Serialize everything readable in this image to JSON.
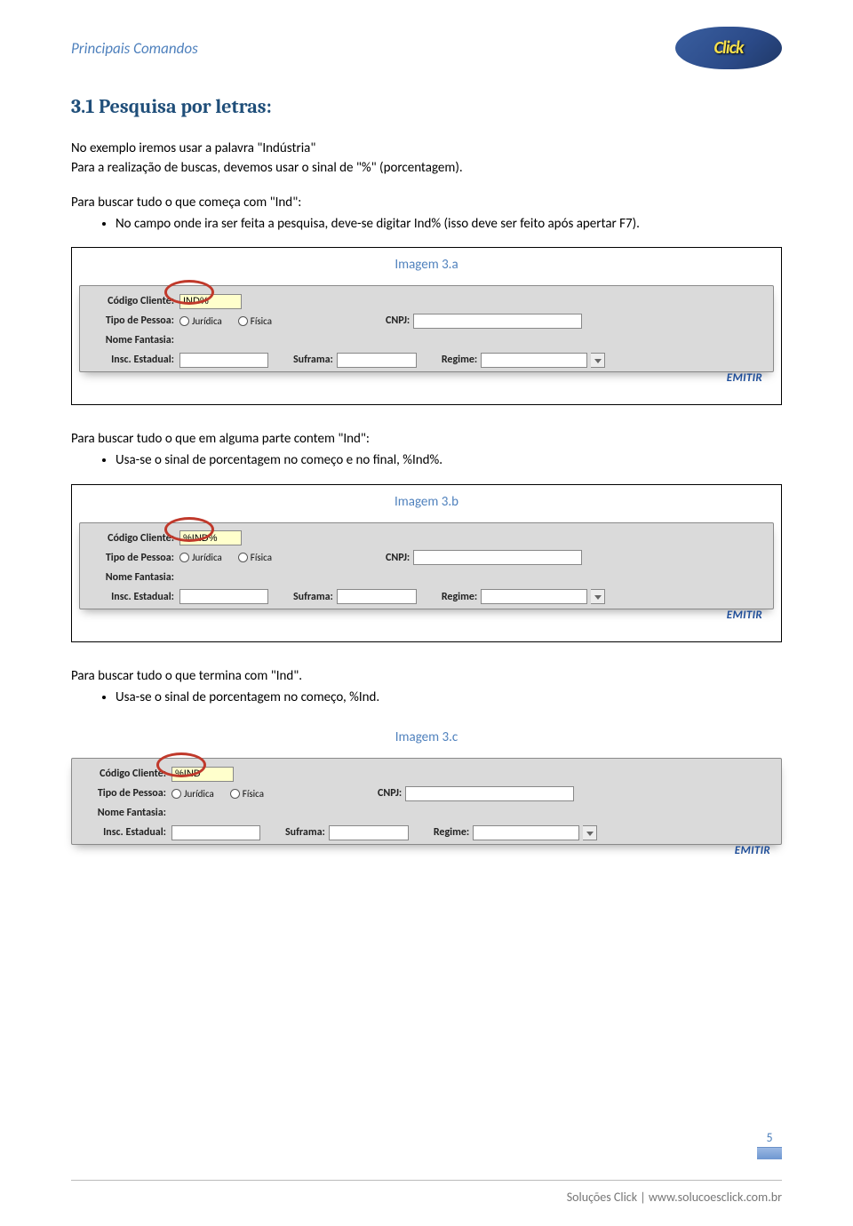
{
  "header": {
    "title": "Principais Comandos",
    "logo_text": "Click"
  },
  "section": {
    "title": "3.1 Pesquisa por letras:"
  },
  "intro": {
    "p1": "No exemplo iremos usar a palavra \"Indústria\"",
    "p2": "Para a realização de buscas, devemos usar o sinal de \"%\" (porcentagem)."
  },
  "blockA": {
    "lead": "Para buscar tudo o que começa com \"Ind\":",
    "bullet": "No campo onde ira ser feita a pesquisa, deve-se digitar Ind% (isso deve ser feito após apertar F7).",
    "caption": "Imagem 3.a",
    "input_value": "IND%"
  },
  "blockB": {
    "lead": "Para buscar tudo o que em alguma parte contem \"Ind\":",
    "bullet": "Usa-se o sinal de porcentagem no começo e no final, %Ind%.",
    "caption": "Imagem 3.b",
    "input_value": "%IND%"
  },
  "blockC": {
    "lead": "Para buscar tudo o que termina com \"Ind\".",
    "bullet": "Usa-se o sinal de porcentagem no começo, %Ind.",
    "caption": "Imagem 3.c",
    "input_value": "%IND"
  },
  "form": {
    "codigo_label": "Código Cliente:",
    "tipo_label": "Tipo de Pessoa:",
    "juridica": "Jurídica",
    "fisica": "Física",
    "cnpj_label": "CNPJ:",
    "nome_label": "Nome Fantasia:",
    "insc_label": "Insc. Estadual:",
    "suframa_label": "Suframa:",
    "regime_label": "Regime:",
    "emitir": "EMITIR"
  },
  "page_number": "5",
  "footer": "Soluções Click | www.solucoesclick.com.br"
}
